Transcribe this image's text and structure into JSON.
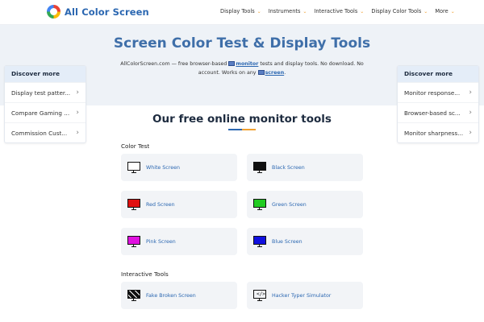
{
  "header": {
    "logo_text": "All Color Screen",
    "nav": [
      {
        "label": "Display Tools"
      },
      {
        "label": "Instruments"
      },
      {
        "label": "Interactive Tools"
      },
      {
        "label": "Display Color Tools"
      },
      {
        "label": "More"
      }
    ],
    "caret": "⌄"
  },
  "hero": {
    "title": "Screen Color Test & Display Tools",
    "intro_part1": "AllColorScreen.com — free browser-based",
    "intro_link1": "monitor",
    "intro_part2": "tests and display tools. No download. No account. Works on any",
    "intro_link2": "screen",
    "intro_end": "."
  },
  "sidebar_left": {
    "heading": "Discover more",
    "items": [
      {
        "label": "Display test patter..."
      },
      {
        "label": "Compare Gaming ..."
      },
      {
        "label": "Commission Cust..."
      }
    ]
  },
  "sidebar_right": {
    "heading": "Discover more",
    "items": [
      {
        "label": "Monitor response..."
      },
      {
        "label": "Browser-based sc..."
      },
      {
        "label": "Monitor sharpness..."
      }
    ]
  },
  "chevron": "›",
  "section": {
    "heading": "Our free online monitor tools",
    "groups": [
      {
        "label": "Color Test",
        "tools": [
          {
            "label": "White Screen",
            "color": "#ffffff"
          },
          {
            "label": "Black Screen",
            "color": "#111111"
          },
          {
            "label": "Red Screen",
            "color": "#e01010"
          },
          {
            "label": "Green Screen",
            "color": "#22cc22"
          },
          {
            "label": "Pink Screen",
            "color": "#e010e0"
          },
          {
            "label": "Blue Screen",
            "color": "#1010e0"
          }
        ]
      },
      {
        "label": "Interactive Tools",
        "tools": [
          {
            "label": "Fake Broken Screen",
            "icon": "broken-screen-icon"
          },
          {
            "label": "Hacker Typer Simulator",
            "icon": "code-terminal-icon",
            "glyph": "</>"
          }
        ]
      }
    ]
  }
}
